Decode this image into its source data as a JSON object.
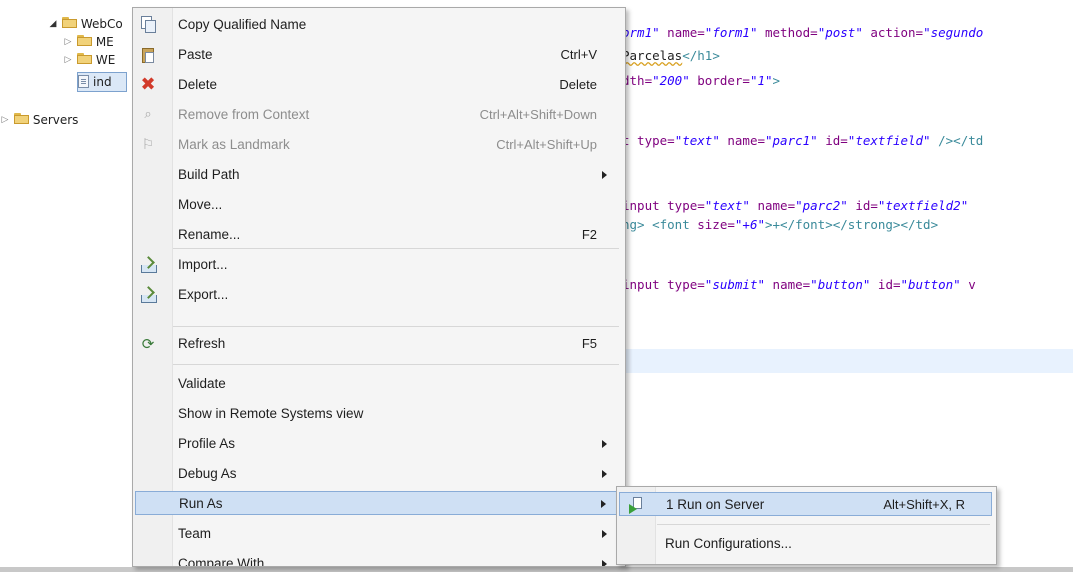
{
  "tree": {
    "project": "WebCo",
    "children": [
      "ME",
      "WE"
    ],
    "selected_file": "ind",
    "servers": "Servers"
  },
  "editor": {
    "lines": [
      {
        "parts": [
          [
            "val",
            "orm1\""
          ],
          [
            "at",
            " name="
          ],
          [
            "val",
            "\"form1\""
          ],
          [
            "at",
            " method="
          ],
          [
            "val",
            "\"post\""
          ],
          [
            "at",
            " action="
          ],
          [
            "val",
            "\"segundo"
          ]
        ]
      },
      {
        "parts": [
          [
            "txt",
            " "
          ],
          [
            "squig",
            "Parcelas"
          ],
          [
            "tag",
            "</h1>"
          ]
        ]
      },
      {
        "parts": [
          [
            "at",
            "dth="
          ],
          [
            "val",
            "\"200\""
          ],
          [
            "at",
            " border="
          ],
          [
            "val",
            "\"1\""
          ],
          [
            "tag",
            ">"
          ]
        ]
      },
      {
        "parts": [
          [
            "at",
            "t type="
          ],
          [
            "val",
            "\"text\""
          ],
          [
            "at",
            " name="
          ],
          [
            "val",
            "\"parc1\""
          ],
          [
            "at",
            " id="
          ],
          [
            "val",
            "\"textfield\""
          ],
          [
            "tag",
            " /></td"
          ]
        ]
      },
      {
        "parts": [
          [
            "at",
            "input type="
          ],
          [
            "val",
            "\"text\""
          ],
          [
            "at",
            " name="
          ],
          [
            "val",
            "\"parc2\""
          ],
          [
            "at",
            " id="
          ],
          [
            "val",
            "\"textfield2\""
          ]
        ]
      },
      {
        "parts": [
          [
            "tag",
            "ng> <font"
          ],
          [
            "at",
            " size="
          ],
          [
            "val",
            "\"+6\""
          ],
          [
            "tag",
            ">+</font></strong></td>"
          ]
        ]
      },
      {
        "parts": [
          [
            "at",
            "input type="
          ],
          [
            "val",
            "\"submit\""
          ],
          [
            "at",
            " name="
          ],
          [
            "val",
            "\"button\""
          ],
          [
            "at",
            " id="
          ],
          [
            "val",
            "\"button\""
          ],
          [
            "at",
            " v"
          ]
        ]
      }
    ]
  },
  "context_menu": {
    "items": [
      {
        "label": "Copy Qualified Name",
        "shortcut": "",
        "icon": "copy-icon"
      },
      {
        "label": "Paste",
        "shortcut": "Ctrl+V",
        "icon": "paste-icon"
      },
      {
        "label": "Delete",
        "shortcut": "Delete",
        "icon": "delete-icon"
      },
      {
        "label": "Remove from Context",
        "shortcut": "Ctrl+Alt+Shift+Down",
        "icon": "remove-context-icon",
        "disabled": true
      },
      {
        "label": "Mark as Landmark",
        "shortcut": "Ctrl+Alt+Shift+Up",
        "icon": "landmark-icon",
        "disabled": true
      },
      {
        "label": "Build Path",
        "shortcut": "",
        "submenu": true
      },
      {
        "label": "Move...",
        "shortcut": ""
      },
      {
        "label": "Rename...",
        "shortcut": "F2"
      },
      {
        "label": "Import...",
        "shortcut": "",
        "icon": "import-icon"
      },
      {
        "label": "Export...",
        "shortcut": "",
        "icon": "export-icon"
      },
      {
        "label": "Refresh",
        "shortcut": "F5",
        "icon": "refresh-icon"
      },
      {
        "label": "Validate",
        "shortcut": ""
      },
      {
        "label": "Show in Remote Systems view",
        "shortcut": ""
      },
      {
        "label": "Profile As",
        "shortcut": "",
        "submenu": true
      },
      {
        "label": "Debug As",
        "shortcut": "",
        "submenu": true
      },
      {
        "label": "Run As",
        "shortcut": "",
        "submenu": true,
        "selected": true
      },
      {
        "label": "Team",
        "shortcut": "",
        "submenu": true
      },
      {
        "label": "Compare With",
        "shortcut": "",
        "submenu": true
      }
    ]
  },
  "run_as_submenu": {
    "items": [
      {
        "label": "1 Run on Server",
        "shortcut": "Alt+Shift+X, R",
        "icon": "run-on-server-icon",
        "selected": true
      },
      {
        "label": "Run Configurations...",
        "shortcut": ""
      }
    ]
  }
}
